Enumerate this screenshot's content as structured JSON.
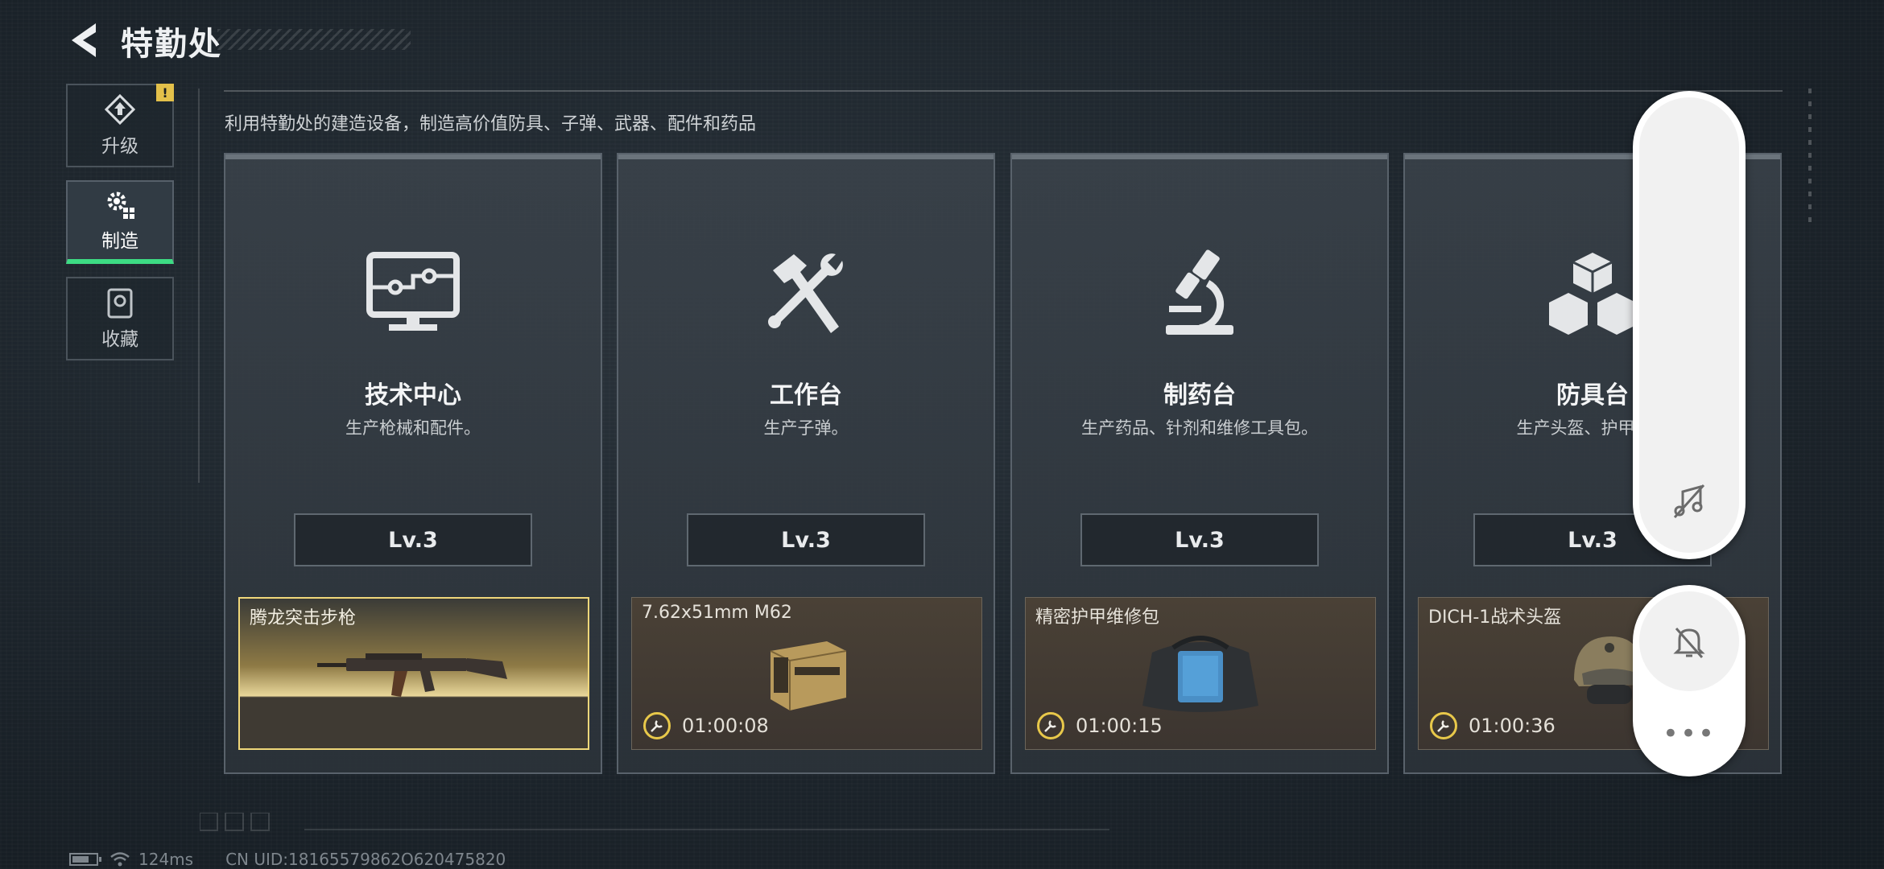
{
  "header": {
    "title": "特勤处"
  },
  "sidebar": {
    "items": [
      {
        "label": "升级",
        "icon": "upgrade-icon",
        "alert": "!"
      },
      {
        "label": "制造",
        "icon": "craft-gear-icon"
      },
      {
        "label": "收藏",
        "icon": "collection-icon"
      }
    ]
  },
  "subtitle": "利用特勤处的建造设备，制造高价值防具、子弹、武器、配件和药品",
  "stations": [
    {
      "name": "技术中心",
      "desc": "生产枪械和配件。",
      "level": "Lv.3",
      "icon": "monitor-circuit-icon",
      "product": {
        "name": "腾龙突击步枪",
        "icon": "assault-rifle-icon",
        "timer": ""
      }
    },
    {
      "name": "工作台",
      "desc": "生产子弹。",
      "level": "Lv.3",
      "icon": "hammer-wrench-icon",
      "product": {
        "name": "7.62x51mm M62",
        "icon": "ammo-box-icon",
        "timer": "01:00:08"
      }
    },
    {
      "name": "制药台",
      "desc": "生产药品、针剂和维修工具包。",
      "level": "Lv.3",
      "icon": "microscope-icon",
      "product": {
        "name": "精密护甲维修包",
        "icon": "repair-kit-bag-icon",
        "timer": "01:00:15"
      }
    },
    {
      "name": "防具台",
      "desc": "生产头盔、护甲、胸",
      "level": "Lv.3",
      "icon": "cubes-icon",
      "product": {
        "name": "DICH-1战术头盔",
        "icon": "tactical-helmet-icon",
        "timer": "01:00:36"
      }
    }
  ],
  "overlay": {
    "icons": [
      "music-off-icon",
      "bell-off-icon",
      "more-dots-icon"
    ],
    "more_label": "•••"
  },
  "status_bar": {
    "ping": "124ms",
    "uid": "CN UID:18165579862O620475820"
  }
}
